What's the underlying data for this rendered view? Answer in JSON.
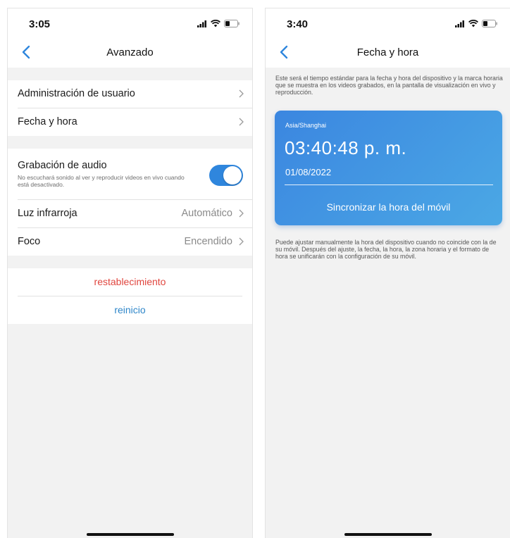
{
  "left": {
    "status_time": "3:05",
    "nav_title": "Avanzado",
    "group1": [
      {
        "label": "Administración de usuario"
      },
      {
        "label": "Fecha y hora"
      }
    ],
    "audio": {
      "label": "Grabación de audio",
      "description": "No escuchará sonido al ver y reproducir videos en vivo cuando está desactivado.",
      "enabled": true
    },
    "infrared": {
      "label": "Luz infrarroja",
      "value": "Automático"
    },
    "focus": {
      "label": "Foco",
      "value": "Encendido"
    },
    "reset_label": "restablecimiento",
    "restart_label": "reinicio"
  },
  "right": {
    "status_time": "3:40",
    "nav_title": "Fecha y hora",
    "notice": "Este será el tiempo estándar para la fecha y hora del dispositivo y la marca horaria que se muestra en los videos grabados, en la pantalla de visualización en vivo y reproducción.",
    "timezone": "Asia/Shanghai",
    "clock": "03:40:48 p. m.",
    "date": "01/08/2022",
    "sync_label": "Sincronizar la hora del móvil",
    "manual_note": "Puede ajustar manualmente la hora del dispositivo cuando no coincide con la de su móvil. Después del ajuste, la fecha, la hora, la zona horaria y el formato de hora se unificarán con la configuración de su móvil."
  },
  "colors": {
    "accent": "#2f86dd",
    "reset": "#e0463f",
    "restart": "#2e86c9",
    "card_gradient_start": "#3b86e0",
    "card_gradient_end": "#4ba8e5"
  },
  "icons": [
    "signal-icon",
    "wifi-icon",
    "battery-icon",
    "back-chevron-icon",
    "chevron-right-icon"
  ]
}
